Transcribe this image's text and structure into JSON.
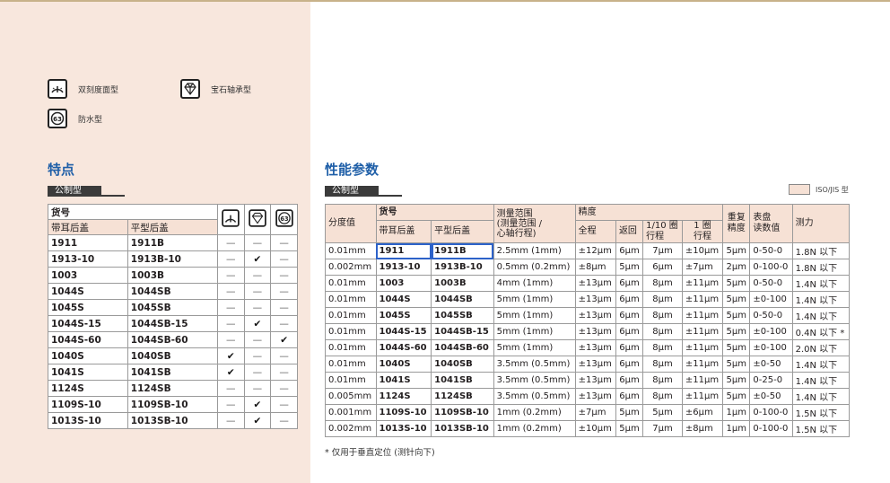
{
  "legend": {
    "dual_scale": "双刻度面型",
    "jewel_bearing": "宝石轴承型",
    "waterproof": "防水型"
  },
  "features": {
    "heading": "特点",
    "tag": "公制型",
    "header": {
      "group": "货号",
      "lug_back": "带耳后盖",
      "flat_back": "平型后盖"
    },
    "rows": [
      {
        "lug": "1911",
        "flat": "1911B",
        "dual": "—",
        "jewel": "—",
        "water": "—"
      },
      {
        "lug": "1913-10",
        "flat": "1913B-10",
        "dual": "—",
        "jewel": "✔",
        "water": "—"
      },
      {
        "lug": "1003",
        "flat": "1003B",
        "dual": "—",
        "jewel": "—",
        "water": "—"
      },
      {
        "lug": "1044S",
        "flat": "1044SB",
        "dual": "—",
        "jewel": "—",
        "water": "—"
      },
      {
        "lug": "1045S",
        "flat": "1045SB",
        "dual": "—",
        "jewel": "—",
        "water": "—"
      },
      {
        "lug": "1044S-15",
        "flat": "1044SB-15",
        "dual": "—",
        "jewel": "✔",
        "water": "—"
      },
      {
        "lug": "1044S-60",
        "flat": "1044SB-60",
        "dual": "—",
        "jewel": "—",
        "water": "✔"
      },
      {
        "lug": "1040S",
        "flat": "1040SB",
        "dual": "✔",
        "jewel": "—",
        "water": "—"
      },
      {
        "lug": "1041S",
        "flat": "1041SB",
        "dual": "✔",
        "jewel": "—",
        "water": "—"
      },
      {
        "lug": "1124S",
        "flat": "1124SB",
        "dual": "—",
        "jewel": "—",
        "water": "—"
      },
      {
        "lug": "1109S-10",
        "flat": "1109SB-10",
        "dual": "—",
        "jewel": "✔",
        "water": "—"
      },
      {
        "lug": "1013S-10",
        "flat": "1013SB-10",
        "dual": "—",
        "jewel": "✔",
        "water": "—"
      }
    ]
  },
  "specs": {
    "heading": "性能参数",
    "tag": "公制型",
    "iso_label": "ISO/JIS 型",
    "header": {
      "graduation": "分度值",
      "order_no": "货号",
      "lug_back": "带耳后盖",
      "flat_back": "平型后盖",
      "range": "测量范围\n(测量范围 /\n心轴行程)",
      "accuracy": "精度",
      "total": "全程",
      "retrace": "返回",
      "tenth_rev": "1/10 圈\n行程",
      "one_rev": "1 圈\n行程",
      "repeat": "重复\n精度",
      "dial": "表盘\n读数值",
      "force": "测力"
    },
    "rows": [
      {
        "grad": "0.01mm",
        "lug": "1911",
        "flat": "1911B",
        "range": "2.5mm (1mm)",
        "total": "±12μm",
        "retrace": "6μm",
        "tenth": "7μm",
        "one": "±10μm",
        "repeat": "5μm",
        "dial": "0-50-0",
        "force": "1.8N 以下"
      },
      {
        "grad": "0.002mm",
        "lug": "1913-10",
        "flat": "1913B-10",
        "range": "0.5mm (0.2mm)",
        "total": "±8μm",
        "retrace": "5μm",
        "tenth": "6μm",
        "one": "±7μm",
        "repeat": "2μm",
        "dial": "0-100-0",
        "force": "1.8N 以下"
      },
      {
        "grad": "0.01mm",
        "lug": "1003",
        "flat": "1003B",
        "range": "4mm (1mm)",
        "total": "±13μm",
        "retrace": "6μm",
        "tenth": "8μm",
        "one": "±11μm",
        "repeat": "5μm",
        "dial": "0-50-0",
        "force": "1.4N 以下"
      },
      {
        "grad": "0.01mm",
        "lug": "1044S",
        "flat": "1044SB",
        "range": "5mm (1mm)",
        "total": "±13μm",
        "retrace": "6μm",
        "tenth": "8μm",
        "one": "±11μm",
        "repeat": "5μm",
        "dial": "±0-100",
        "force": "1.4N 以下"
      },
      {
        "grad": "0.01mm",
        "lug": "1045S",
        "flat": "1045SB",
        "range": "5mm (1mm)",
        "total": "±13μm",
        "retrace": "6μm",
        "tenth": "8μm",
        "one": "±11μm",
        "repeat": "5μm",
        "dial": "0-50-0",
        "force": "1.4N 以下"
      },
      {
        "grad": "0.01mm",
        "lug": "1044S-15",
        "flat": "1044SB-15",
        "range": "5mm (1mm)",
        "total": "±13μm",
        "retrace": "6μm",
        "tenth": "8μm",
        "one": "±11μm",
        "repeat": "5μm",
        "dial": "±0-100",
        "force": "0.4N 以下 *"
      },
      {
        "grad": "0.01mm",
        "lug": "1044S-60",
        "flat": "1044SB-60",
        "range": "5mm (1mm)",
        "total": "±13μm",
        "retrace": "6μm",
        "tenth": "8μm",
        "one": "±11μm",
        "repeat": "5μm",
        "dial": "±0-100",
        "force": "2.0N 以下"
      },
      {
        "grad": "0.01mm",
        "lug": "1040S",
        "flat": "1040SB",
        "range": "3.5mm (0.5mm)",
        "total": "±13μm",
        "retrace": "6μm",
        "tenth": "8μm",
        "one": "±11μm",
        "repeat": "5μm",
        "dial": "±0-50",
        "force": "1.4N 以下"
      },
      {
        "grad": "0.01mm",
        "lug": "1041S",
        "flat": "1041SB",
        "range": "3.5mm (0.5mm)",
        "total": "±13μm",
        "retrace": "6μm",
        "tenth": "8μm",
        "one": "±11μm",
        "repeat": "5μm",
        "dial": "0-25-0",
        "force": "1.4N 以下"
      },
      {
        "grad": "0.005mm",
        "lug": "1124S",
        "flat": "1124SB",
        "range": "3.5mm (0.5mm)",
        "total": "±13μm",
        "retrace": "6μm",
        "tenth": "8μm",
        "one": "±11μm",
        "repeat": "5μm",
        "dial": "±0-50",
        "force": "1.4N 以下"
      },
      {
        "grad": "0.001mm",
        "lug": "1109S-10",
        "flat": "1109SB-10",
        "range": "1mm (0.2mm)",
        "total": "±7μm",
        "retrace": "5μm",
        "tenth": "5μm",
        "one": "±6μm",
        "repeat": "1μm",
        "dial": "0-100-0",
        "force": "1.5N 以下"
      },
      {
        "grad": "0.002mm",
        "lug": "1013S-10",
        "flat": "1013SB-10",
        "range": "1mm (0.2mm)",
        "total": "±10μm",
        "retrace": "5μm",
        "tenth": "7μm",
        "one": "±8μm",
        "repeat": "1μm",
        "dial": "0-100-0",
        "force": "1.5N 以下"
      }
    ]
  },
  "footnote": "* 仅用于垂直定位 (测针向下)",
  "colors": {
    "accent": "#1f5fa8",
    "panel": "#f8e7dd",
    "header": "#f6e1d5",
    "select": "#2d62c9"
  }
}
